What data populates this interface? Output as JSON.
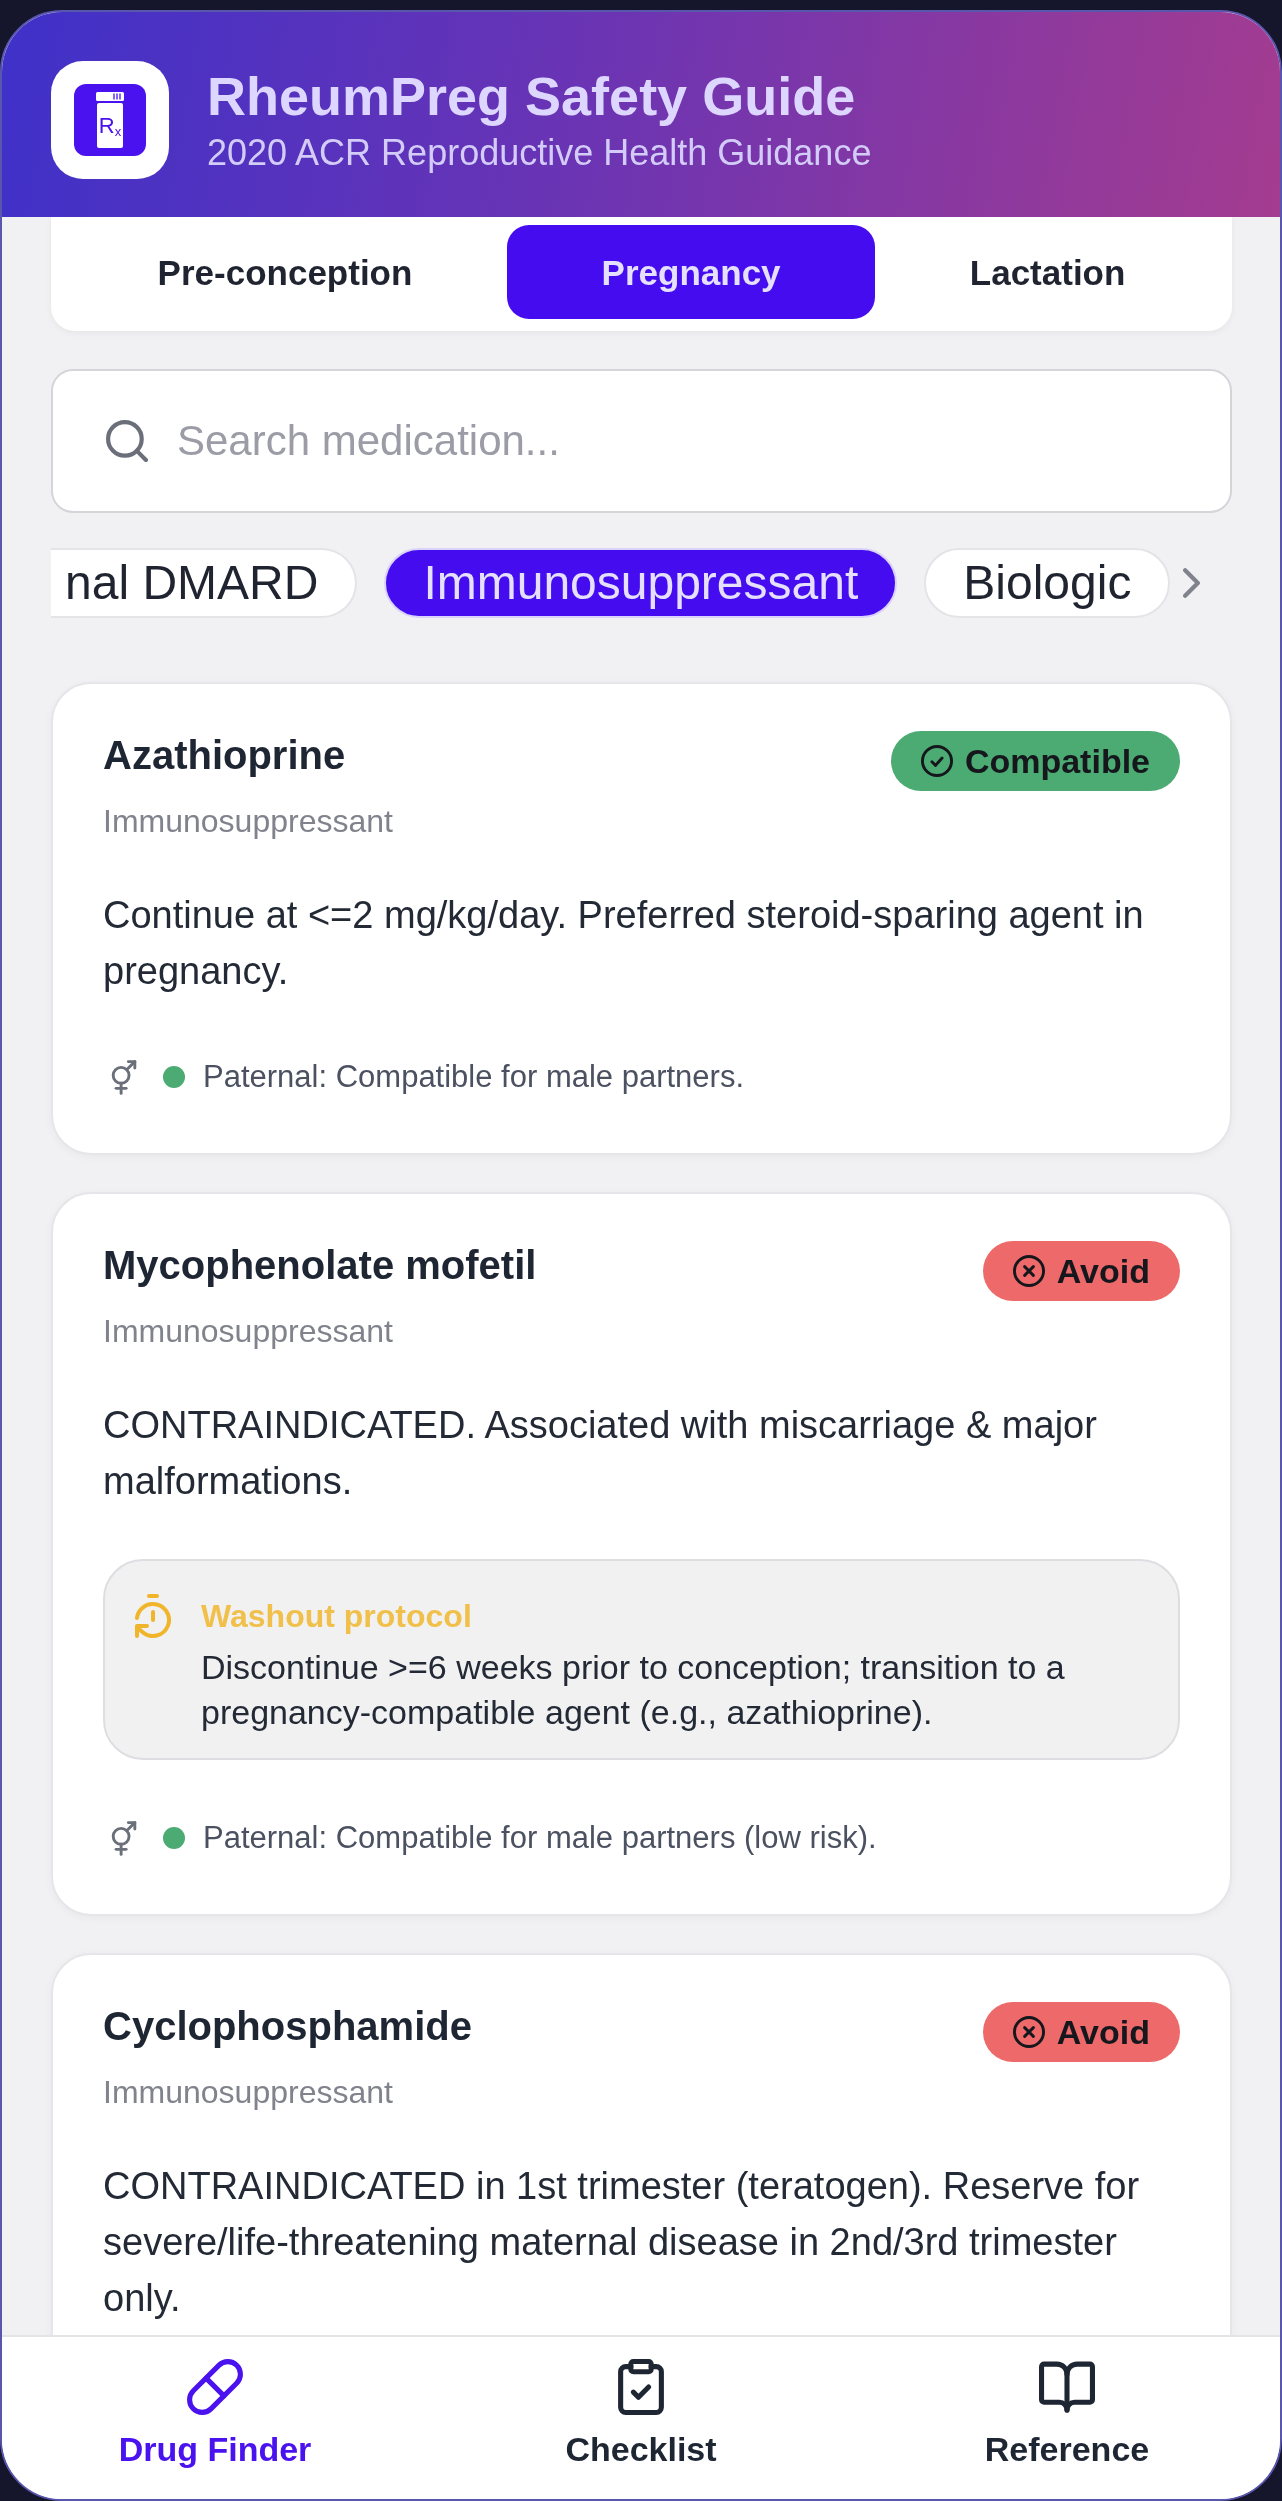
{
  "header": {
    "logo_text": "R$_{x}$",
    "title": "RheumPreg Safety Guide",
    "subtitle": "2020 ACR Reproductive Health Guidance"
  },
  "tabs": [
    {
      "label": "Pre-conception",
      "selected": false
    },
    {
      "label": "Pregnancy",
      "selected": true
    },
    {
      "label": "Lactation",
      "selected": false
    }
  ],
  "search": {
    "placeholder": "Search medication..."
  },
  "filters": [
    {
      "label": "nal DMARD",
      "selected": false
    },
    {
      "label": "Immunosuppressant",
      "selected": true
    },
    {
      "label": "Biologic",
      "selected": false
    }
  ],
  "drugs": [
    {
      "name": "Azathioprine",
      "category": "Immunosuppressant",
      "status": {
        "kind": "compatible",
        "label": "Compatible"
      },
      "guidance": "Continue at <=2 mg/kg/day. Preferred steroid-sparing agent in pregnancy.",
      "paternal": {
        "text": "Paternal: Compatible for male partners.",
        "color": "#4caa73"
      }
    },
    {
      "name": "Mycophenolate mofetil",
      "category": "Immunosuppressant",
      "status": {
        "kind": "avoid",
        "label": "Avoid"
      },
      "guidance": "CONTRAINDICATED. Associated with miscarriage & major malformations.",
      "washout": {
        "title": "Washout protocol",
        "text": "Discontinue >=6 weeks prior to conception; transition to a pregnancy-compatible agent (e.g., azathioprine)."
      },
      "paternal": {
        "text": "Paternal: Compatible for male partners (low risk).",
        "color": "#4caa73"
      }
    },
    {
      "name": "Cyclophosphamide",
      "category": "Immunosuppressant",
      "status": {
        "kind": "avoid",
        "label": "Avoid"
      },
      "guidance": "CONTRAINDICATED in 1st trimester (teratogen). Reserve for severe/life-threatening maternal disease in 2nd/3rd trimester only."
    }
  ],
  "nav": [
    {
      "label": "Drug Finder",
      "selected": true
    },
    {
      "label": "Checklist",
      "selected": false
    },
    {
      "label": "Reference",
      "selected": false
    }
  ]
}
